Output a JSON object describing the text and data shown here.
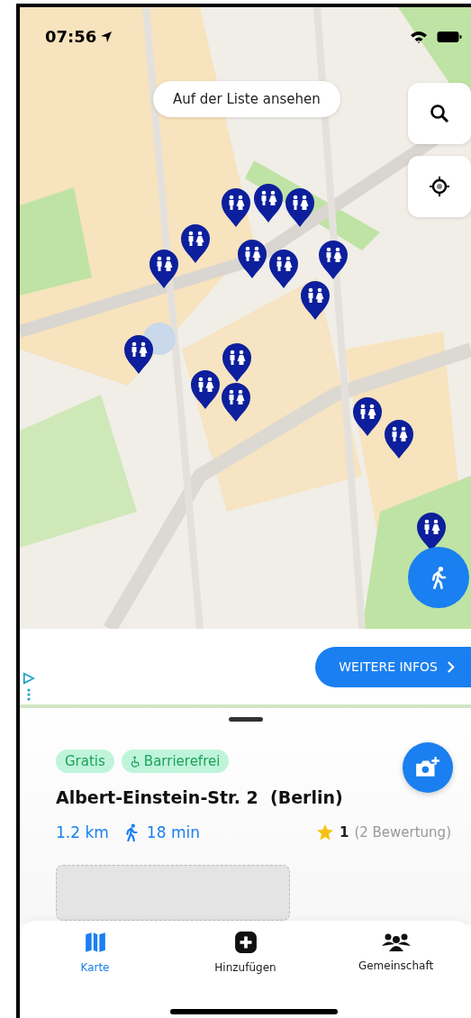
{
  "status_bar": {
    "time": "07:56"
  },
  "map": {
    "list_button": "Auf der Liste ansehen"
  },
  "ad": {
    "button": "WEITERE INFOS"
  },
  "place": {
    "tags": [
      {
        "label": "Gratis",
        "kind": "plain"
      },
      {
        "label": "Barrierefrei",
        "kind": "accessible"
      }
    ],
    "title": "Albert-Einstein-Str. 2  (Berlin)",
    "distance_value": "1.2",
    "distance_unit": "km",
    "walk_time": "18 min",
    "rating": "1",
    "reviews": "(2 Bewertung)"
  },
  "tabs": [
    {
      "label": "Karte",
      "kind": "map",
      "selected": true
    },
    {
      "label": "Hinzufügen",
      "kind": "add",
      "selected": false
    },
    {
      "label": "Gemeinschaft",
      "kind": "community",
      "selected": false
    }
  ]
}
